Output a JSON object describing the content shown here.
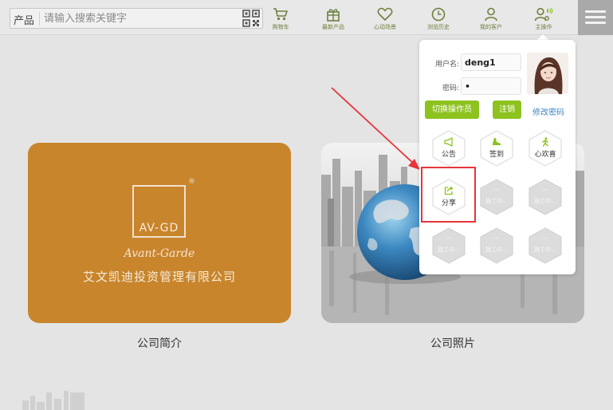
{
  "search": {
    "category": "产品",
    "placeholder": "请输入搜索关键字",
    "qr_icon": "qr-code-icon"
  },
  "nav": [
    {
      "label": "购物车",
      "icon": "shopping-cart-icon"
    },
    {
      "label": "最新产品",
      "icon": "gift-icon"
    },
    {
      "label": "心动场景",
      "icon": "heart-icon"
    },
    {
      "label": "浏览历史",
      "icon": "clock-icon"
    },
    {
      "label": "我的客户",
      "icon": "user-icon"
    },
    {
      "label": "主操作",
      "icon": "operator-icon"
    }
  ],
  "menu_icon": "hamburger-menu-icon",
  "cards": {
    "profile": {
      "logo_text": "AV-GD",
      "logo_mark": "®",
      "script_text": "Avant-Garde",
      "company_name": "艾文凯迪投资管理有限公司",
      "caption": "公司简介"
    },
    "photo": {
      "caption": "公司照片"
    }
  },
  "panel": {
    "username_label": "用户名:",
    "username_value": "deng1",
    "password_label": "密码:",
    "password_value": "•",
    "switch_operator_label": "切换操作员",
    "logout_label": "注销",
    "change_password_label": "修改密码",
    "tiles": [
      {
        "label": "公告",
        "icon": "megaphone-icon",
        "enabled": true
      },
      {
        "label": "签到",
        "icon": "shoe-icon",
        "enabled": true
      },
      {
        "label": "心欢喜",
        "icon": "running-person-icon",
        "enabled": true
      },
      {
        "label": "分享",
        "icon": "share-icon",
        "enabled": true
      },
      {
        "label": "施工中...",
        "enabled": false
      },
      {
        "label": "施工中...",
        "enabled": false
      },
      {
        "label": "施工中...",
        "enabled": false
      },
      {
        "label": "施工中...",
        "enabled": false
      },
      {
        "label": "施工中...",
        "enabled": false
      }
    ]
  },
  "colors": {
    "accent_green": "#8dc21f",
    "nav_green": "#6e7f3d",
    "link_blue": "#3d87c6",
    "highlight_red": "#e8343a",
    "card_orange": "#c9852c"
  }
}
